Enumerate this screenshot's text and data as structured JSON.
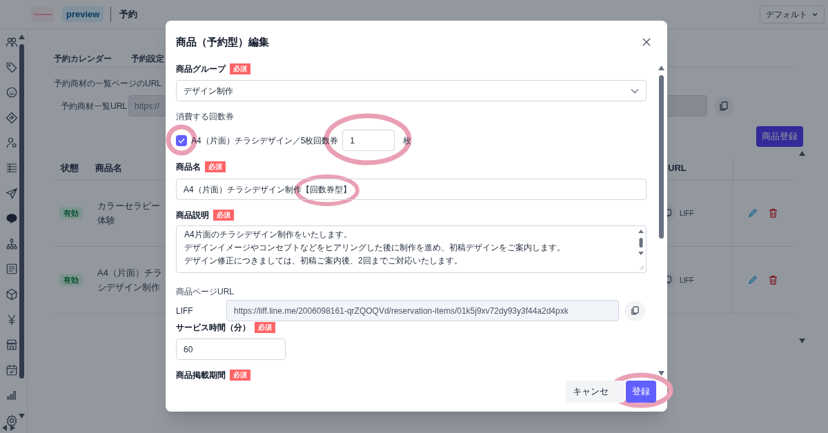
{
  "header": {
    "badge": "preview",
    "title": "予約",
    "view_select": "デフォルト"
  },
  "tabs": [
    {
      "label": "予約カレンダー",
      "selected": false
    },
    {
      "label": "予約設定",
      "selected": false
    }
  ],
  "url_section": {
    "description": "予約商材の一覧ページのURL",
    "label": "予約商材一覧URL",
    "value": "https://"
  },
  "add_button": "商品登録",
  "table": {
    "columns": [
      "状態",
      "商品名",
      "URL"
    ],
    "rows": [
      {
        "status": "有効",
        "name_lines": [
          "カラーセラピー",
          "体験"
        ],
        "url_label": "LIFF"
      },
      {
        "status": "有効",
        "name_lines": [
          "A4（片面）チラ",
          "シデザイン制作"
        ],
        "url_label": "LIFF"
      }
    ]
  },
  "modal": {
    "title": "商品（予約型）編集",
    "product_group": {
      "label": "商品グループ",
      "badge": "必須",
      "value": "デザイン制作"
    },
    "tickets": {
      "label": "消費する回数券",
      "items": [
        {
          "label": "A4（片面）チラシデザイン／5枚回数券",
          "checked": true,
          "quantity": "1",
          "unit": "枚"
        }
      ]
    },
    "product_name": {
      "label": "商品名",
      "badge": "必須",
      "value": "A4（片面）チラシデザイン制作【回数券型】"
    },
    "description": {
      "label": "商品説明",
      "badge": "必須",
      "lines": [
        "A4片面のチラシデザイン制作をいたします。",
        "デザインイメージやコンセプトなどをヒアリングした後に制作を進め、初稿デザインをご案内します。",
        "デザイン修正につきましては、初稿ご案内後、2回までご対応いたします。"
      ]
    },
    "page_url": {
      "label": "商品ページURL",
      "liff_label": "LIFF",
      "value": "https://liff.line.me/2006098161-qrZQOQVd/reservation-items/01k5j9xv72dy93y3f44a2d4pxk"
    },
    "service_time": {
      "label": "サービス時間（分）",
      "badge": "必須",
      "value": "60"
    },
    "listing_period": {
      "label": "商品掲載期間",
      "badge": "必須"
    },
    "buttons": {
      "cancel": "キャンセ",
      "submit": "登録"
    }
  }
}
